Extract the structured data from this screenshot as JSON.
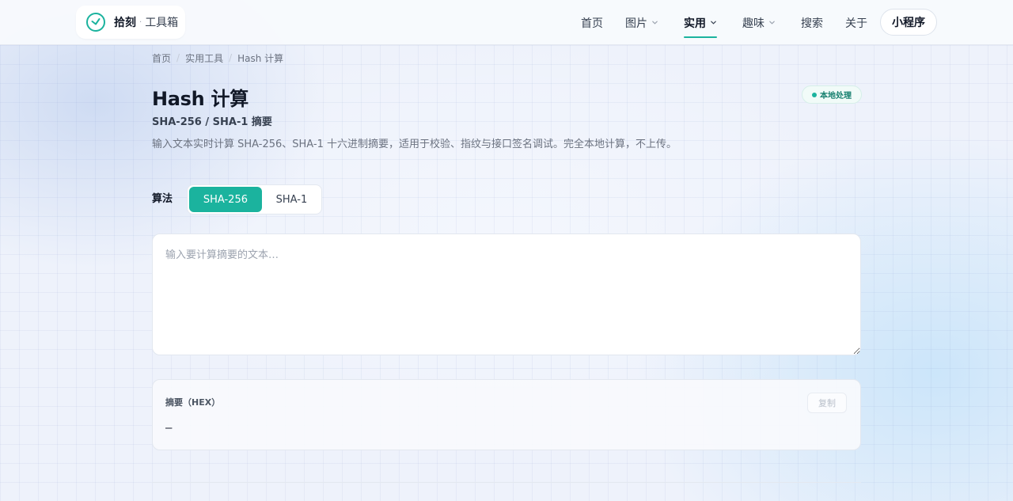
{
  "header": {
    "logo": {
      "name": "拾刻",
      "separator": "·",
      "subtitle": "工具箱"
    },
    "nav": [
      {
        "label": "首页",
        "has_dropdown": false,
        "active": false
      },
      {
        "label": "图片",
        "has_dropdown": true,
        "active": false
      },
      {
        "label": "实用",
        "has_dropdown": true,
        "active": true
      },
      {
        "label": "趣味",
        "has_dropdown": true,
        "active": false
      },
      {
        "label": "搜索",
        "has_dropdown": false,
        "active": false
      },
      {
        "label": "关于",
        "has_dropdown": false,
        "active": false
      }
    ],
    "mini_program_label": "小程序"
  },
  "breadcrumb": {
    "items": [
      "首页",
      "实用工具"
    ],
    "separator": "/",
    "current": "Hash 计算"
  },
  "page": {
    "title": "Hash 计算",
    "subtitle": "SHA-256 / SHA-1 摘要",
    "description": "输入文本实时计算 SHA-256、SHA-1 十六进制摘要，适用于校验、指纹与接口签名调试。完全本地计算，不上传。",
    "badge": "本地处理"
  },
  "algorithm": {
    "label": "算法",
    "options": [
      "SHA-256",
      "SHA-1"
    ],
    "selected": "SHA-256"
  },
  "input": {
    "value": "",
    "placeholder": "输入要计算摘要的文本…"
  },
  "output": {
    "label": "摘要（HEX）",
    "copy_label": "复制",
    "value": "—"
  },
  "colors": {
    "accent": "#1bb39e",
    "text_primary": "#111827",
    "text_secondary": "#6b7280",
    "background": "#eef2fb"
  },
  "icons": {
    "logo": "clock-icon",
    "dropdown": "chevron-down-icon",
    "badge": "status-dot-icon"
  }
}
